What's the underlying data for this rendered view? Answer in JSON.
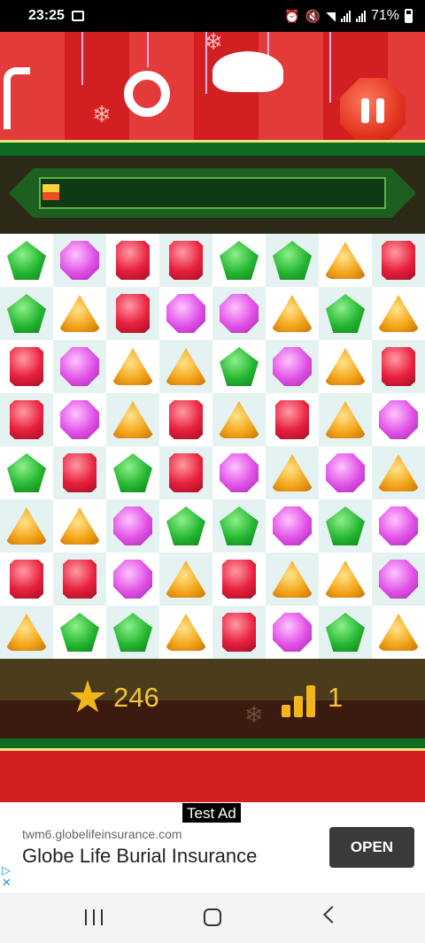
{
  "status_bar": {
    "time": "23:25",
    "battery": "71%",
    "icons": [
      "image-icon",
      "alarm-icon",
      "mute-icon",
      "wifi-icon",
      "signal-icon",
      "signal-icon",
      "battery-icon"
    ]
  },
  "game": {
    "progress_fraction": 0.05,
    "score": "246",
    "level": "1",
    "board": [
      [
        "green",
        "purple",
        "red",
        "red",
        "green",
        "green",
        "orange",
        "red"
      ],
      [
        "green",
        "orange",
        "red",
        "purple",
        "purple",
        "orange",
        "green",
        "orange"
      ],
      [
        "red",
        "purple",
        "orange",
        "orange",
        "green",
        "purple",
        "orange",
        "red"
      ],
      [
        "red",
        "purple",
        "orange",
        "red",
        "orange",
        "red",
        "orange",
        "purple"
      ],
      [
        "green",
        "red",
        "green",
        "red",
        "purple",
        "orange",
        "purple",
        "orange"
      ],
      [
        "orange",
        "orange",
        "purple",
        "green",
        "green",
        "purple",
        "green",
        "purple"
      ],
      [
        "red",
        "red",
        "purple",
        "orange",
        "red",
        "orange",
        "orange",
        "purple"
      ],
      [
        "orange",
        "green",
        "green",
        "orange",
        "red",
        "purple",
        "green",
        "orange"
      ]
    ]
  },
  "ad": {
    "label": "Test Ad",
    "url": "twm6.globelifeinsurance.com",
    "title": "Globe Life Burial Insurance",
    "cta": "OPEN"
  },
  "colors": {
    "header_red": "#d21f21",
    "header_green": "#0d6b24",
    "score_gold": "#f2c23a"
  }
}
